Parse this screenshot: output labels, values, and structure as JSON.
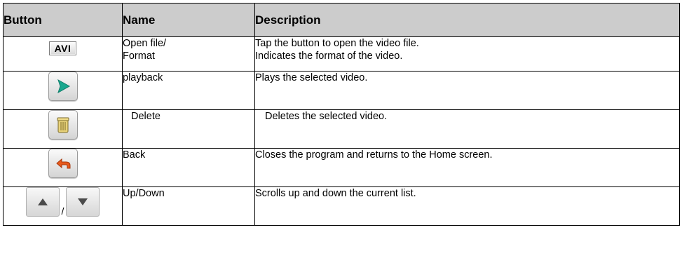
{
  "headers": {
    "button": "Button",
    "name": "Name",
    "description": "Description"
  },
  "rows": [
    {
      "icon": "avi-format-icon",
      "badge": "AVI",
      "name_line1": "Open file/",
      "name_line2": "Format",
      "desc_line1": "Tap the button to open the video file.",
      "desc_line2": "Indicates the format of the video."
    },
    {
      "icon": "play-icon",
      "name": "playback",
      "desc": "Plays the selected video."
    },
    {
      "icon": "trash-icon",
      "name": "Delete",
      "desc": "Deletes the selected video."
    },
    {
      "icon": "back-arrow-icon",
      "name": "Back",
      "desc": "Closes the program and returns to the Home screen."
    },
    {
      "icon": "up-down-arrows-icon",
      "separator": "/",
      "name": "Up/Down",
      "desc": "Scrolls up and down the current list."
    }
  ],
  "colors": {
    "header_bg": "#cccccc",
    "play": "#1aa88f",
    "back": "#e85a1c",
    "arrow": "#4a4a4a"
  }
}
